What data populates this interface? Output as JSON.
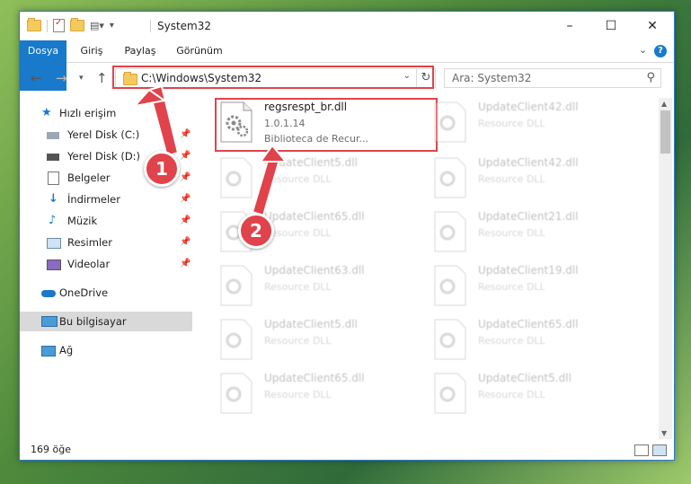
{
  "window": {
    "title": "System32",
    "controls": {
      "minimize": "–",
      "maximize": "☐",
      "close": "✕"
    }
  },
  "ribbon": {
    "tabs": [
      "Dosya",
      "Giriş",
      "Paylaş",
      "Görünüm"
    ],
    "help": "?"
  },
  "address_bar": {
    "path": "C:\\Windows\\System32",
    "search_placeholder": "Ara: System32"
  },
  "nav_pane": {
    "items": [
      {
        "label": "Hızlı erişim",
        "icon": "star-icon"
      },
      {
        "label": "Yerel Disk (C:)",
        "icon": "drive-icon",
        "pinned": true
      },
      {
        "label": "Yerel Disk (D:)",
        "icon": "drive-icon",
        "pinned": true
      },
      {
        "label": "Belgeler",
        "icon": "documents-icon",
        "pinned": true
      },
      {
        "label": "İndirmeler",
        "icon": "download-icon",
        "pinned": true
      },
      {
        "label": "Müzik",
        "icon": "music-icon",
        "pinned": true
      },
      {
        "label": "Resimler",
        "icon": "pictures-icon",
        "pinned": true
      },
      {
        "label": "Videolar",
        "icon": "videos-icon",
        "pinned": true
      },
      {
        "label": "OneDrive",
        "icon": "cloud-icon"
      },
      {
        "label": "Bu bilgisayar",
        "icon": "computer-icon",
        "selected": true
      },
      {
        "label": "Ağ",
        "icon": "network-icon"
      }
    ]
  },
  "files": [
    {
      "name": "regsrespt_br.dll",
      "version": "1.0.1.14",
      "type": "Biblioteca de Recur...",
      "highlighted": true
    },
    {
      "name": "UpdateClient42.dll",
      "type": "Resource DLL"
    },
    {
      "name": "UpdateClient5.dll",
      "type": "Resource DLL"
    },
    {
      "name": "UpdateClient42.dll",
      "type": "Resource DLL"
    },
    {
      "name": "UpdateClient65.dll",
      "type": "Resource DLL"
    },
    {
      "name": "UpdateClient21.dll",
      "type": "Resource DLL"
    },
    {
      "name": "UpdateClient63.dll",
      "type": "Resource DLL"
    },
    {
      "name": "UpdateClient19.dll",
      "type": "Resource DLL"
    },
    {
      "name": "UpdateClient5.dll",
      "type": "Resource DLL"
    },
    {
      "name": "UpdateClient65.dll",
      "type": "Resource DLL"
    },
    {
      "name": "UpdateClient65.dll",
      "type": "Resource DLL"
    },
    {
      "name": "UpdateClient5.dll",
      "type": "Resource DLL"
    }
  ],
  "status": {
    "item_count": "169 öğe"
  },
  "annotations": [
    "1",
    "2"
  ],
  "colors": {
    "accent": "#1979ca",
    "highlight": "#e0434b"
  }
}
